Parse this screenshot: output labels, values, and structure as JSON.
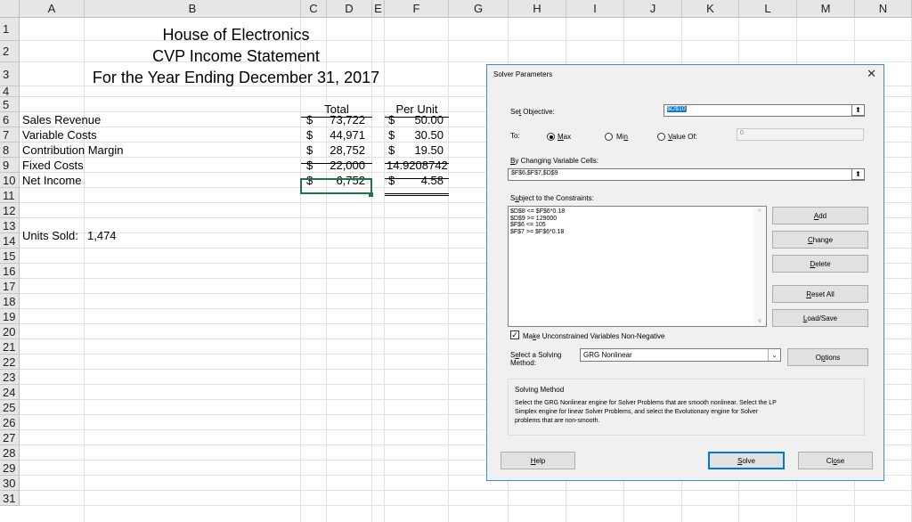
{
  "columns": [
    "A",
    "B",
    "C",
    "D",
    "E",
    "F",
    "G",
    "H",
    "I",
    "J",
    "K",
    "L",
    "M",
    "N"
  ],
  "rows": [
    "1",
    "2",
    "3",
    "4",
    "5",
    "6",
    "7",
    "8",
    "9",
    "10",
    "11",
    "12",
    "13",
    "14",
    "15",
    "16",
    "17",
    "18",
    "19",
    "20",
    "21",
    "22",
    "23",
    "24",
    "25",
    "26",
    "27",
    "28",
    "29",
    "30",
    "31"
  ],
  "sheet": {
    "title1": "House of Electronics",
    "title2": "CVP Income Statement",
    "title3": "For the Year Ending December 31, 2017",
    "hdr_total": "Total",
    "hdr_per_unit": "Per Unit",
    "labels": [
      "Sales Revenue",
      "Variable Costs",
      "Contribution Margin",
      "Fixed Costs",
      "Net Income"
    ],
    "dollar": "$",
    "totals": [
      "73,722",
      "44,971",
      "28,752",
      "22,000",
      "6,752"
    ],
    "per_unit_dollar": [
      "$",
      "$",
      "$",
      "",
      "$"
    ],
    "per_unit": [
      "50.00",
      "30.50",
      "19.50",
      "14.9208742",
      "4.58"
    ],
    "units_label": "Units Sold:",
    "units_value": "1,474"
  },
  "dialog": {
    "title": "Solver Parameters",
    "close_icon": "close-icon",
    "set_objective_label": "Set Objective:",
    "objective_value": "$D$10",
    "to_label": "To:",
    "max_label": "Max",
    "min_label": "Min",
    "value_of_label": "Value Of:",
    "value_of_value": "0",
    "changing_cells_label": "By Changing Variable Cells:",
    "changing_cells_value": "$F$6,$F$7,$D$9",
    "constraints_label": "Subject to the Constraints:",
    "constraints": [
      "$D$8 <= $F$6*0.18",
      "$D$9 >= 129000",
      "$F$6 <= 105",
      "$F$7 >= $F$6*0.18"
    ],
    "add_label": "Add",
    "change_label": "Change",
    "delete_label": "Delete",
    "reset_label": "Reset All",
    "load_save_label": "Load/Save",
    "nonneg_label": "Make Unconstrained Variables Non-Negative",
    "select_method_label_1": "Select a Solving",
    "select_method_label_2": "Method:",
    "method_value": "GRG Nonlinear",
    "options_label": "Options",
    "solving_method_heading": "Solving Method",
    "solving_method_text_1": "Select the GRG Nonlinear engine for Solver Problems that are smooth nonlinear. Select the LP",
    "solving_method_text_2": "Simplex engine for linear Solver Problems, and select the Evolutionary engine for Solver",
    "solving_method_text_3": "problems that are non-smooth.",
    "help_label": "Help",
    "solve_label": "Solve",
    "close_label": "Close"
  }
}
